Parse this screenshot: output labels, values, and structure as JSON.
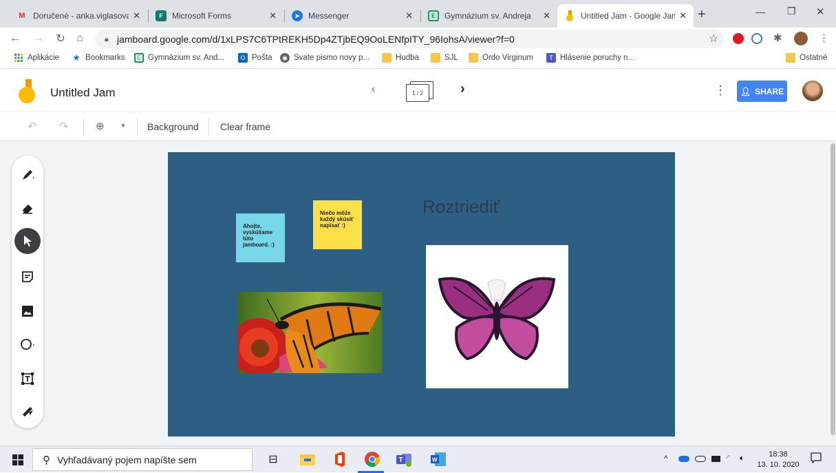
{
  "browser": {
    "tabs": [
      {
        "title": "Doručené - anka.viglasova@",
        "favicon": "gmail-icon",
        "active": false
      },
      {
        "title": "Microsoft Forms",
        "favicon": "forms-icon",
        "active": false
      },
      {
        "title": "Messenger",
        "favicon": "messenger-icon",
        "active": false
      },
      {
        "title": "Gymnázium sv. Andreja",
        "favicon": "edupage-icon",
        "active": false
      },
      {
        "title": "Untitled Jam - Google Jamboard",
        "favicon": "jamboard-icon",
        "active": true
      }
    ],
    "new_tab_symbol": "+",
    "url": "jamboard.google.com/d/1xLPS7C6TPtREKH5Dp4ZTjbEQ9OoLENfpITY_96IohsA/viewer?f=0",
    "bookmarks": [
      {
        "label": "Aplikácie",
        "icon": "apps-icon"
      },
      {
        "label": "Bookmarks",
        "icon": "star-icon"
      },
      {
        "label": "Gymnázium sv. And...",
        "icon": "edupage-icon"
      },
      {
        "label": "Pošta",
        "icon": "outlook-icon"
      },
      {
        "label": "Svate pismo novy p...",
        "icon": "globe-icon"
      },
      {
        "label": "Hudba",
        "icon": "folder-icon"
      },
      {
        "label": "SJL",
        "icon": "folder-icon"
      },
      {
        "label": "Ordo Virginum",
        "icon": "folder-icon"
      },
      {
        "label": "Hlásenie poruchy n...",
        "icon": "teams-icon"
      }
    ],
    "other_bookmarks": "Ostatné"
  },
  "jam": {
    "title": "Untitled Jam",
    "frame_counter": "1 / 2",
    "share_label": "SHARE",
    "toolbar": {
      "background_label": "Background",
      "clear_frame_label": "Clear frame"
    },
    "canvas": {
      "heading": "Roztriediť",
      "sticky_blue": "Ahojte, vyskúšame túto jamboard. :)",
      "sticky_yellow": "Niečo môže každý skúsiť napísať :)",
      "colors": {
        "canvas": "#2d5f85",
        "sticky_blue": "#76d7e8",
        "sticky_yellow": "#fde047",
        "accent": "#4285f4"
      }
    }
  },
  "taskbar": {
    "search_placeholder": "Vyhľadávaný pojem napíšte sem",
    "time": "18:38",
    "date": "13. 10. 2020"
  }
}
